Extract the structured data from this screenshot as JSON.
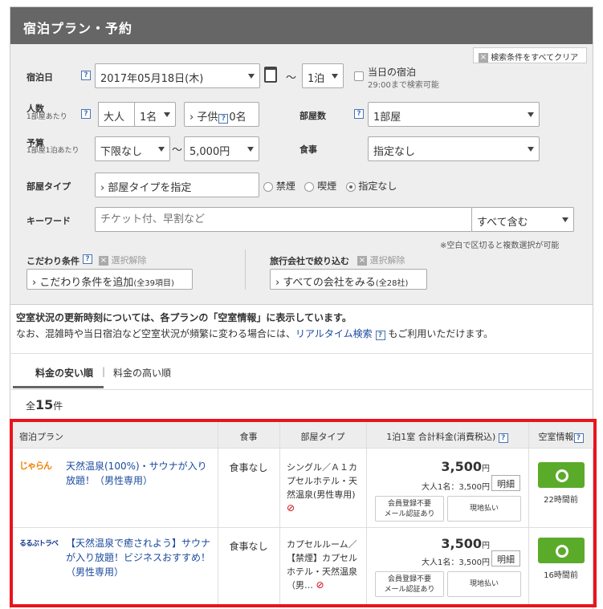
{
  "header": {
    "title": "宿泊プラン・予約"
  },
  "form": {
    "clear_label": "検索条件をすべてクリア",
    "checkin": {
      "label": "宿泊日",
      "date": "2017年05月18日(木)",
      "tilde": "〜",
      "nights": "1泊",
      "sameday_label": "当日の宿泊",
      "sameday_note": "29:00まで検索可能"
    },
    "people": {
      "label": "人数",
      "sub": "1部屋あたり",
      "adult_label": "大人",
      "adult_value": "1名",
      "child_label": "› 子供",
      "child_value": "0名"
    },
    "rooms": {
      "label": "部屋数",
      "value": "1部屋"
    },
    "budget": {
      "label": "予算",
      "sub": "1部屋1泊あたり",
      "min": "下限なし",
      "tilde": "〜",
      "max": "5,000円"
    },
    "meal": {
      "label": "食事",
      "value": "指定なし"
    },
    "roomtype": {
      "label": "部屋タイプ",
      "button": "› 部屋タイプを指定",
      "options": [
        "禁煙",
        "喫煙",
        "指定なし"
      ]
    },
    "keyword": {
      "label": "キーワード",
      "placeholder": "チケット付、早割など",
      "mode": "すべて含む",
      "note": "※空白で区切ると複数選択が可能"
    },
    "kodawari": {
      "label": "こだわり条件",
      "clear": "選択解除",
      "button": "› こだわり条件を追加",
      "count": "(全39項目)"
    },
    "agency": {
      "label": "旅行会社で絞り込む",
      "clear": "選択解除",
      "button": "› すべての会社をみる",
      "count": "(全28社)"
    }
  },
  "notice": {
    "line1": "空室状況の更新時刻については、各プランの「空室情報」に表示しています。",
    "line2_pre": "なお、混雑時や当日宿泊など空室状況が頻繁に変わる場合には、",
    "line2_link": "リアルタイム検索",
    "line2_post": "もご利用いただけます。"
  },
  "sort": {
    "tab_active": "料金の安い順",
    "separator": "|",
    "tab_other": "料金の高い順"
  },
  "count": {
    "prefix": "全",
    "number": "15",
    "suffix": "件"
  },
  "table": {
    "headers": {
      "plan": "宿泊プラン",
      "meal": "食事",
      "room": "部屋タイプ",
      "price": "1泊1室 合計料金(消費税込)",
      "status": "空室情報"
    },
    "rows": [
      {
        "logo": "じゃらん",
        "plan": "天然温泉(100%)・サウナが入り放題！（男性専用）",
        "meal": "食事なし",
        "room": "シングル／Ａ１カプセルホテル・天然温泉(男性専用)",
        "price": "3,500",
        "yen": "円",
        "per": "大人1名：3,500円",
        "detail": "明細",
        "ticket1": "会員登録不要\nメール認証あり",
        "ticket2": "現地払い",
        "updated": "22時間前"
      },
      {
        "logo": "るるぶトラベル",
        "plan": "【天然温泉で癒されよう】サウナが入り放題！ビジネスおすすめ！（男性専用）",
        "meal": "食事なし",
        "room": "カプセルルーム／【禁煙】カプセルホテル・天然温泉（男…",
        "price": "3,500",
        "yen": "円",
        "per": "大人1名：3,500円",
        "detail": "明細",
        "ticket1": "会員登録不要\nメール認証あり",
        "ticket2": "現地払い",
        "updated": "16時間前"
      }
    ]
  }
}
